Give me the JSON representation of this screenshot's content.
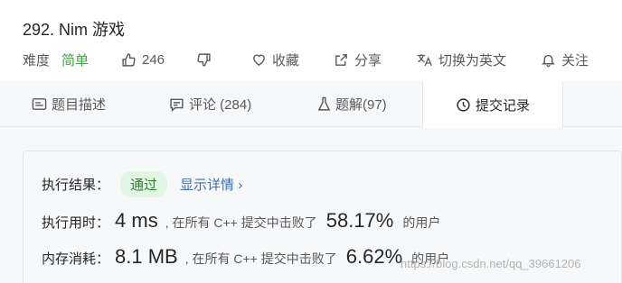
{
  "problem": {
    "title": "292. Nim 游戏",
    "difficulty_label": "难度",
    "difficulty_value": "简单",
    "likes": "246",
    "favorite_label": "收藏",
    "share_label": "分享",
    "language_switch_label": "切换为英文",
    "follow_label": "关注"
  },
  "tabs": [
    {
      "label": "题目描述",
      "icon": "description-icon"
    },
    {
      "label": "评论 (284)",
      "icon": "comment-icon"
    },
    {
      "label": "题解(97)",
      "icon": "flask-icon"
    },
    {
      "label": "提交记录",
      "icon": "clock-icon"
    }
  ],
  "result": {
    "status_label": "执行结果：",
    "status_value": "通过",
    "detail_link": "显示详情",
    "runtime_label": "执行用时：",
    "runtime_value": "4 ms",
    "runtime_text": ", 在所有 C++ 提交中击败了",
    "runtime_percent": "58.17%",
    "memory_label": "内存消耗：",
    "memory_value": "8.1 MB",
    "memory_text": ", 在所有 C++ 提交中击败了",
    "memory_percent": "6.62%",
    "users_suffix": "的用户"
  },
  "watermark": "https://blog.csdn.net/qq_39661206",
  "colors": {
    "difficulty_easy": "#43a047",
    "pass_badge_bg": "#e3f5e4",
    "pass_badge_text": "#2e7d32",
    "link": "#3f6fb0"
  }
}
